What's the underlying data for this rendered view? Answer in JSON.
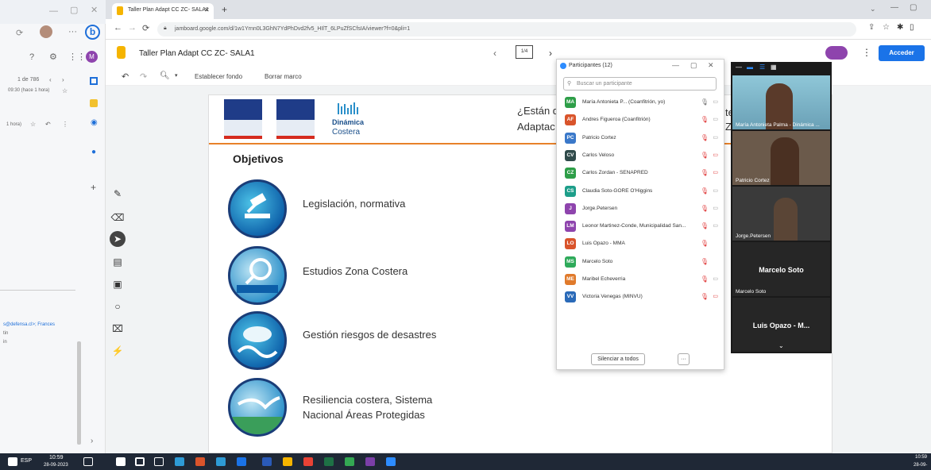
{
  "browser": {
    "tab_title": "Taller Plan Adapt CC ZC- SALA1",
    "url": "jamboard.google.com/d/1w1Yrnn0L3GhN7YdPhDvd2fv5_HIlT_6LPuZfSCfsIA/viewer?f=0&pli=1"
  },
  "left_app": {
    "pagination": "1 de 786",
    "time_text": "09:30 (hace 1 hora)",
    "time_text_2": "1 hora)",
    "email_snippet": "s@defensa.cl>; Frances",
    "snippet_2": "tin",
    "snippet_3": "in",
    "avatar_initial": "M"
  },
  "jamboard": {
    "title": "Taller Plan Adapt CC ZC- SALA1",
    "frame_indicator": "1/4",
    "set_background": "Establecer fondo",
    "clear_frame": "Borrar marco",
    "access_button": "Acceder"
  },
  "slide": {
    "brand_line1": "Dinámica",
    "brand_line2": "Costera",
    "question_line1": "¿Están d",
    "question_line2": "Adaptac",
    "question_frag1": "te",
    "question_frag2": "Zo",
    "objectives_title": "Objetivos",
    "objectives": [
      "Legislación, normativa",
      "Estudios Zona Costera",
      "Gestión riesgos de desastres",
      "Resiliencia costera, Sistema",
      "Nacional Áreas Protegidas"
    ]
  },
  "participants": {
    "title": "Participantes (12)",
    "search_placeholder": "Buscar un participante",
    "list": [
      {
        "initials": "MA",
        "name": "María Antonieta P... (Coanfitrión, yo)",
        "color": "#2e9e48"
      },
      {
        "initials": "AF",
        "name": "Andres Figueroa (Coanfitrión)",
        "color": "#d9542b"
      },
      {
        "initials": "PC",
        "name": "Patricio Cortez",
        "color": "#3a78c9"
      },
      {
        "initials": "CV",
        "name": "Carlos Veloso",
        "color": "#2f4a4a"
      },
      {
        "initials": "CZ",
        "name": "Carlos Zordan - SENAPRED",
        "color": "#2e9e48"
      },
      {
        "initials": "CS",
        "name": "Claudia Soto-GORE O'Higgins",
        "color": "#1d9e8a"
      },
      {
        "initials": "J",
        "name": "Jorge.Petersen",
        "color": "#8e44ad"
      },
      {
        "initials": "LM",
        "name": "Leonor Martinez-Conde, Municipalidad San...",
        "color": "#8e44ad"
      },
      {
        "initials": "LO",
        "name": "Luis Opazo - MMA",
        "color": "#d9542b"
      },
      {
        "initials": "MS",
        "name": "Marcelo Soto",
        "color": "#2eaa5a"
      },
      {
        "initials": "ME",
        "name": "Maribel Echeverria",
        "color": "#e07a2b"
      },
      {
        "initials": "VV",
        "name": "Victoria Venegas (MINVU)",
        "color": "#2a6ab8"
      }
    ],
    "mute_all": "Silenciar a todos",
    "more": "···"
  },
  "videos": {
    "tile1": "María Antonieta Palma - Dinámica ...",
    "tile2": "Patricio Cortez",
    "tile3": "Jorge.Petersen",
    "tile4_big": "Marcelo Soto",
    "tile4_label": "Marcelo Soto",
    "tile5_big": "Luis Opazo - M..."
  },
  "taskbar": {
    "lang": "ESP",
    "time": "10:59",
    "date": "28-09-2023",
    "time_right": "10:59",
    "date_right": "28-09-"
  }
}
